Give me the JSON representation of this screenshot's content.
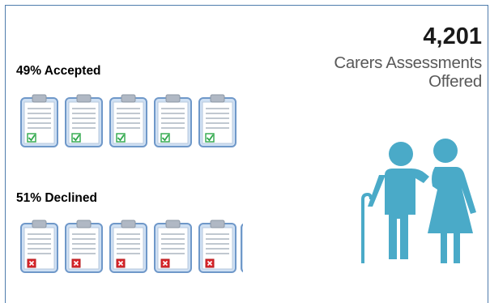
{
  "accepted": {
    "label": "49% Accepted",
    "mark": "check-mark"
  },
  "declined": {
    "label": "51% Declined",
    "mark": "cross-mark"
  },
  "offered": {
    "count": "4,201",
    "line1": "Carers Assessments",
    "line2": "Offered"
  },
  "colors": {
    "clipboard_fill": "#cfe0f3",
    "clipboard_border": "#6f98c9",
    "check": "#2ea84a",
    "cross": "#d9262b",
    "people": "#4aaac8"
  },
  "icons": {
    "clipboard": "clipboard-icon",
    "people": "elderly-couple-icon"
  }
}
